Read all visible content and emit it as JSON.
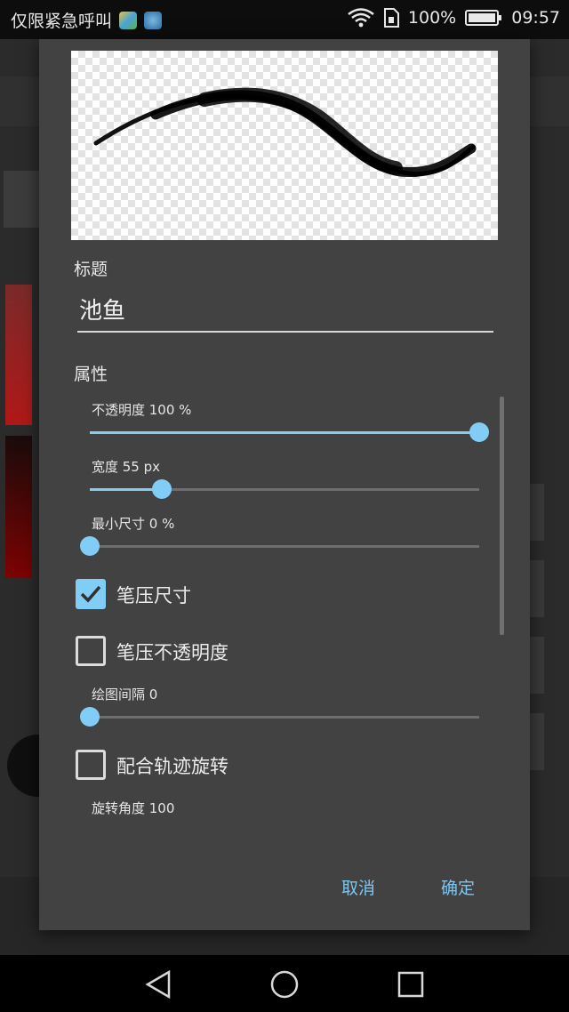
{
  "status_bar": {
    "carrier": "仅限紧急呼叫",
    "battery_percent": "100%",
    "time": "09:57"
  },
  "dialog": {
    "title_label": "标题",
    "title_value": "池鱼",
    "properties_label": "属性",
    "sliders": [
      {
        "label": "不透明度  100  %",
        "value_fraction": 1.0
      },
      {
        "label": "宽度  55  px",
        "value_fraction": 0.184
      },
      {
        "label": "最小尺寸  0  %",
        "value_fraction": 0.0
      },
      {
        "label": "绘图间隔  0",
        "value_fraction": 0.0
      }
    ],
    "checkboxes": [
      {
        "label": "笔压尺寸",
        "checked": true
      },
      {
        "label": "笔压不透明度",
        "checked": false
      },
      {
        "label": "配合轨迹旋转",
        "checked": false
      }
    ],
    "rotation_label": "旋转角度  100",
    "cancel_label": "取消",
    "ok_label": "确定"
  },
  "colors": {
    "accent": "#81cdf5",
    "dialog_bg": "#424242"
  }
}
